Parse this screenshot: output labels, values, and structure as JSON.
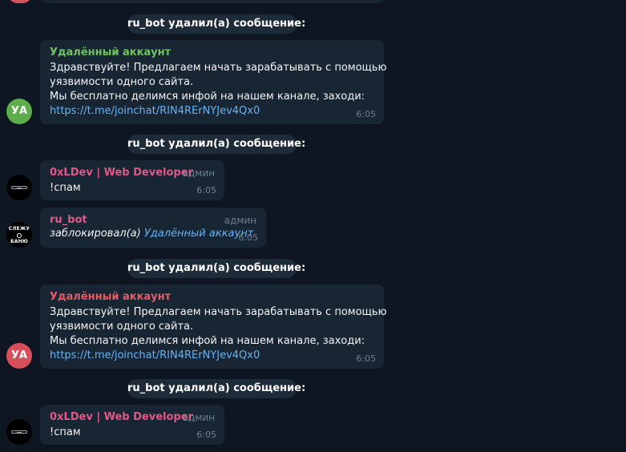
{
  "service_messages": [
    "ru_bot удалил(а) сообщение:",
    "ru_bot удалил(а) сообщение:",
    "ru_bot удалил(а) сообщение:",
    "ru_bot удалил(а) сообщение:"
  ],
  "messages": [
    {
      "sender": "Удалённый аккаунт",
      "avatar_initials": "УА",
      "lines": [
        "Здравствуйте! Предлагаем начать зарабатывать с помощью",
        "уязвимости одного сайта.",
        "Мы бесплатно делимся инфой на нашем канале, заходи:"
      ],
      "link": "https://t.me/joinchat/RIN4RErNYJev4Qx0",
      "time": "6:05"
    },
    {
      "sender": "0xLDev | Web Developer",
      "role": "админ",
      "text": "!спам",
      "time": "6:05"
    },
    {
      "sender": "ru_bot",
      "role": "админ",
      "avatar_lines": [
        "СЛЕЖУ",
        "БАНЮ"
      ],
      "action": "заблокировал(а)",
      "action_target": "Удалённый аккаунт",
      "time": "6:05"
    },
    {
      "sender": "Удалённый аккаунт",
      "avatar_initials": "УА",
      "lines": [
        "Здравствуйте! Предлагаем начать зарабатывать с помощью",
        "уязвимости одного сайта.",
        "Мы бесплатно делимся инфой на нашем канале, заходи:"
      ],
      "link": "https://t.me/joinchat/RIN4RErNYJev4Qx0",
      "time": "6:05"
    },
    {
      "sender": "0xLDev | Web Developer",
      "role": "админ",
      "text": "!спам",
      "time": "6:05"
    }
  ],
  "colors": {
    "background": "#0e1621",
    "bubble": "#182533",
    "service_pill": "#1e2c3a",
    "link": "#6ab2f2",
    "sender_green": "#6ec362",
    "sender_red": "#e25d68",
    "sender_pink": "#e0588a",
    "avatar_green": "#5cae4a",
    "avatar_red": "#d84f5b"
  }
}
